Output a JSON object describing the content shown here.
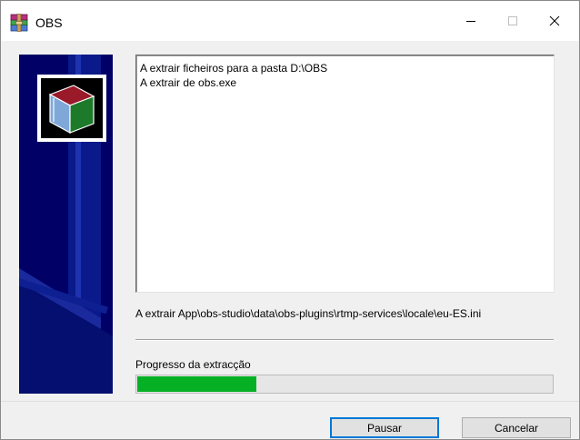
{
  "window": {
    "title": "OBS",
    "icons": {
      "app": "winrar-archive-icon",
      "minimize": "minimize-icon",
      "maximize": "maximize-icon",
      "close": "close-icon"
    }
  },
  "banner": {
    "logo_icon": "archive-box-icon"
  },
  "log": {
    "lines": [
      "A extrair ficheiros para a pasta D:\\OBS",
      "A extrair de obs.exe"
    ]
  },
  "status": {
    "current_file": "A extrair App\\obs-studio\\data\\obs-plugins\\rtmp-services\\locale\\eu-ES.ini"
  },
  "progress": {
    "label": "Progresso da extracção",
    "value_percent": 29,
    "color": "#06b025"
  },
  "buttons": {
    "pause": "Pausar",
    "cancel": "Cancelar"
  },
  "colors": {
    "banner_bg": "#000066",
    "focus_border": "#0078d7"
  }
}
